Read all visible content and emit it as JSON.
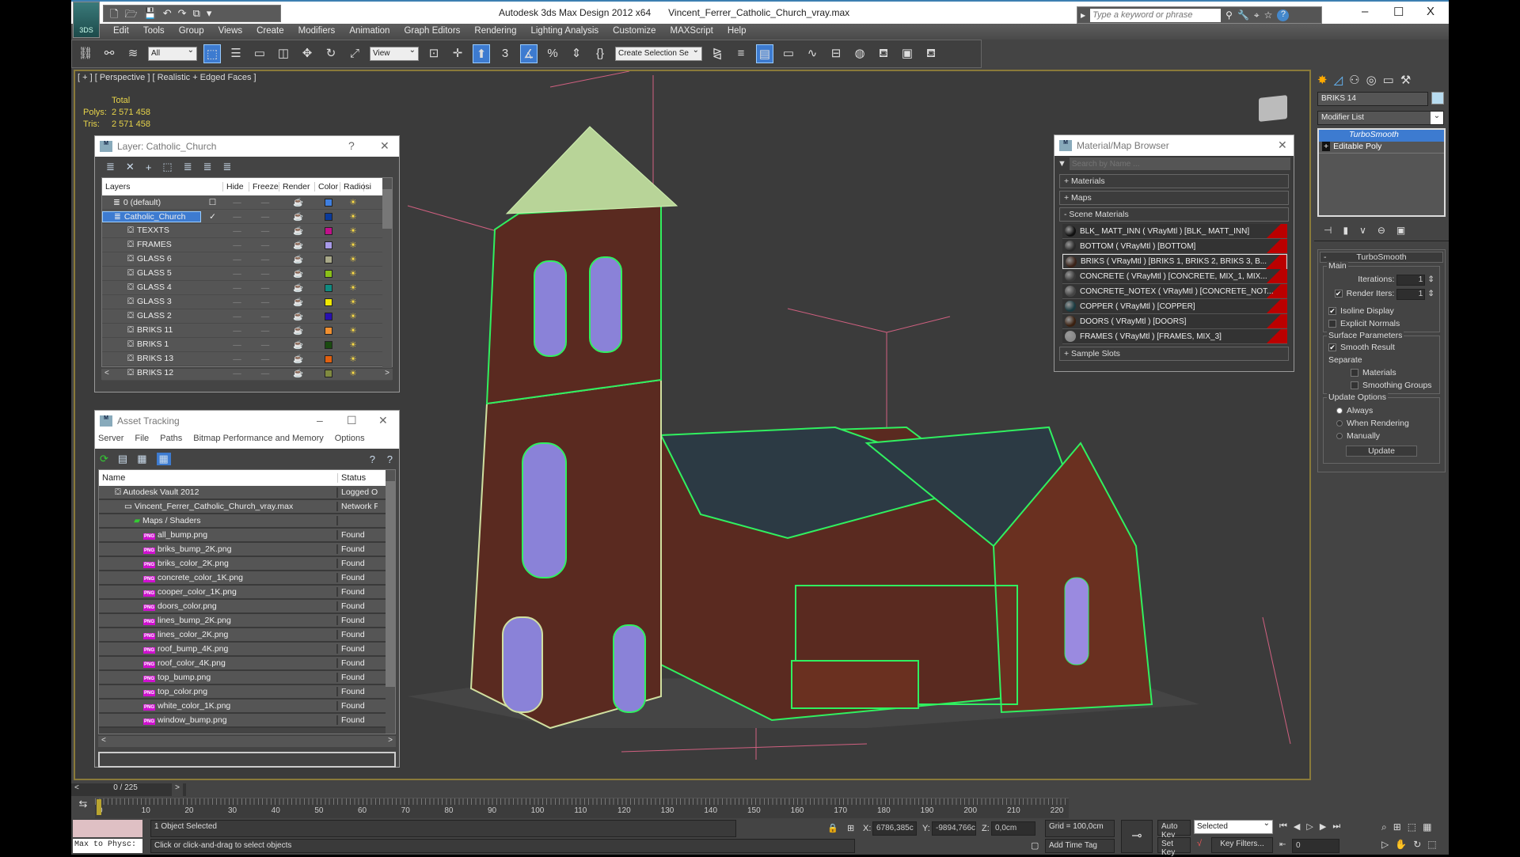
{
  "app": {
    "title": "Autodesk 3ds Max Design 2012 x64",
    "file": "Vincent_Ferrer_Catholic_Church_vray.max",
    "logo": "3DS",
    "search_placeholder": "Type a keyword or phrase",
    "window_controls": {
      "minimize": "–",
      "maximize": "☐",
      "close": "X"
    }
  },
  "menu": [
    "Edit",
    "Tools",
    "Group",
    "Views",
    "Create",
    "Modifiers",
    "Animation",
    "Graph Editors",
    "Rendering",
    "Lighting Analysis",
    "Customize",
    "MAXScript",
    "Help"
  ],
  "toolbar": {
    "filter": "All",
    "ref_coord": "View",
    "selection_set": "Create Selection Se",
    "snap3": "3",
    "percent": "%"
  },
  "viewport": {
    "label": "[ + ] [ Perspective ] [ Realistic + Edged Faces ]",
    "stats": {
      "header": "Total",
      "polys_label": "Polys:",
      "polys": "2 571 458",
      "tris_label": "Tris:",
      "tris": "2 571 458"
    }
  },
  "layer_dialog": {
    "title": "Layer: Catholic_Church",
    "help": "?",
    "close": "✕",
    "columns": [
      "Layers",
      "Hide",
      "Freeze",
      "Render",
      "Color",
      "Radiosi"
    ],
    "rows": [
      {
        "name": "0 (default)",
        "color": "#3f7fe0",
        "level": 0
      },
      {
        "name": "Catholic_Church",
        "color": "#0a3a9a",
        "level": 0,
        "selected": true
      },
      {
        "name": "TEXXTS",
        "color": "#c0108a",
        "level": 1
      },
      {
        "name": "FRAMES",
        "color": "#a89ae8",
        "level": 1
      },
      {
        "name": "GLASS 6",
        "color": "#a8a888",
        "level": 1
      },
      {
        "name": "GLASS 5",
        "color": "#8ac018",
        "level": 1
      },
      {
        "name": "GLASS 4",
        "color": "#108a80",
        "level": 1
      },
      {
        "name": "GLASS 3",
        "color": "#f0e800",
        "level": 1
      },
      {
        "name": "GLASS 2",
        "color": "#2810b0",
        "level": 1
      },
      {
        "name": "BRIKS 11",
        "color": "#f09030",
        "level": 1
      },
      {
        "name": "BRIKS 1",
        "color": "#1a4a10",
        "level": 1
      },
      {
        "name": "BRIKS 13",
        "color": "#e06010",
        "level": 1
      },
      {
        "name": "BRIKS 12",
        "color": "#808a40",
        "level": 1
      }
    ]
  },
  "asset_tracking": {
    "title": "Asset Tracking",
    "menu": [
      "Server",
      "File",
      "Paths",
      "Bitmap Performance and Memory",
      "Options"
    ],
    "columns": [
      "Name",
      "Status"
    ],
    "rows": [
      {
        "name": "Autodesk Vault 2012",
        "status": "Logged Ou",
        "level": 0,
        "type": "vault"
      },
      {
        "name": "Vincent_Ferrer_Catholic_Church_vray.max",
        "status": "Network Pa",
        "level": 1,
        "type": "max"
      },
      {
        "name": "Maps / Shaders",
        "status": "",
        "level": 2,
        "type": "folder"
      },
      {
        "name": "all_bump.png",
        "status": "Found",
        "level": 3,
        "type": "png"
      },
      {
        "name": "briks_bump_2K.png",
        "status": "Found",
        "level": 3,
        "type": "png"
      },
      {
        "name": "briks_color_2K.png",
        "status": "Found",
        "level": 3,
        "type": "png"
      },
      {
        "name": "concrete_color_1K.png",
        "status": "Found",
        "level": 3,
        "type": "png"
      },
      {
        "name": "cooper_color_1K.png",
        "status": "Found",
        "level": 3,
        "type": "png"
      },
      {
        "name": "doors_color.png",
        "status": "Found",
        "level": 3,
        "type": "png"
      },
      {
        "name": "lines_bump_2K.png",
        "status": "Found",
        "level": 3,
        "type": "png"
      },
      {
        "name": "lines_color_2K.png",
        "status": "Found",
        "level": 3,
        "type": "png"
      },
      {
        "name": "roof_bump_4K.png",
        "status": "Found",
        "level": 3,
        "type": "png"
      },
      {
        "name": "roof_color_4K.png",
        "status": "Found",
        "level": 3,
        "type": "png"
      },
      {
        "name": "top_bump.png",
        "status": "Found",
        "level": 3,
        "type": "png"
      },
      {
        "name": "top_color.png",
        "status": "Found",
        "level": 3,
        "type": "png"
      },
      {
        "name": "white_color_1K.png",
        "status": "Found",
        "level": 3,
        "type": "png"
      },
      {
        "name": "window_bump.png",
        "status": "Found",
        "level": 3,
        "type": "png"
      }
    ]
  },
  "material_browser": {
    "title": "Material/Map Browser",
    "search_placeholder": "Search by Name ...",
    "sections": {
      "materials": "+ Materials",
      "maps": "+ Maps",
      "scene": "- Scene Materials",
      "samples": "+ Sample Slots"
    },
    "scene_materials": [
      {
        "label": "BLK_ MATT_INN  ( VRayMtl ) [BLK_ MATT_INN]",
        "color": "#111"
      },
      {
        "label": "BOTTOM  ( VRayMtl ) [BOTTOM]",
        "color": "#2a2a2a"
      },
      {
        "label": "BRIKS  ( VRayMtl )  [BRIKS 1, BRIKS 2, BRIKS 3, B...",
        "color": "#3a2218",
        "selected": true
      },
      {
        "label": "CONCRETE  ( VRayMtl )  [CONCRETE, MIX_1, MIX...",
        "color": "#3a3a3a"
      },
      {
        "label": "CONCRETE_NOTEX  ( VRayMtl )  [CONCRETE_NOT...",
        "color": "#444"
      },
      {
        "label": "COPPER  ( VRayMtl ) [COPPER]",
        "color": "#1a3a40"
      },
      {
        "label": "DOORS  ( VRayMtl ) [DOORS]",
        "color": "#3a2010"
      },
      {
        "label": "FRAMES  ( VRayMtl ) [FRAMES, MIX_3]",
        "color": "#888"
      }
    ]
  },
  "command_panel": {
    "object_name": "BRIKS 14",
    "object_color": "#b8dcf0",
    "modifier_list": "Modifier List",
    "stack": [
      "TurboSmooth",
      "Editable Poly"
    ],
    "rollout": "TurboSmooth",
    "main": {
      "title": "Main",
      "iterations_label": "Iterations:",
      "iterations": "1",
      "render_iters_label": "Render Iters:",
      "render_iters": "1",
      "render_iters_checked": true,
      "isoline_label": "Isoline Display",
      "isoline": true,
      "explicit_label": "Explicit Normals",
      "explicit": false
    },
    "surface": {
      "title": "Surface Parameters",
      "smooth_label": "Smooth Result",
      "smooth": true,
      "separate": "Separate",
      "materials": "Materials",
      "smoothing_groups": "Smoothing Groups"
    },
    "update": {
      "title": "Update Options",
      "options": [
        "Always",
        "When Rendering",
        "Manually"
      ],
      "selected": "Always",
      "button": "Update"
    }
  },
  "timeline": {
    "position": "0 / 225",
    "current": 0,
    "end": 225,
    "ticks": [
      "0",
      "10",
      "20",
      "30",
      "40",
      "50",
      "60",
      "70",
      "80",
      "90",
      "100",
      "110",
      "120",
      "130",
      "140",
      "150",
      "160",
      "170",
      "180",
      "190",
      "200",
      "210",
      "220"
    ]
  },
  "status": {
    "selected": "1 Object Selected",
    "prompt": "Click or click-and-drag to select objects",
    "script": "Max to Physc:",
    "x_label": "X:",
    "x": "6786,385c",
    "y_label": "Y:",
    "y": "-9894,766c",
    "z_label": "Z:",
    "z": "0,0cm",
    "grid": "Grid = 100,0cm",
    "add_time_tag": "Add Time Tag",
    "auto_key": "Auto Key",
    "set_key": "Set Key",
    "key_mode": "Selected",
    "key_filters": "Key Filters...",
    "frame": "0"
  }
}
